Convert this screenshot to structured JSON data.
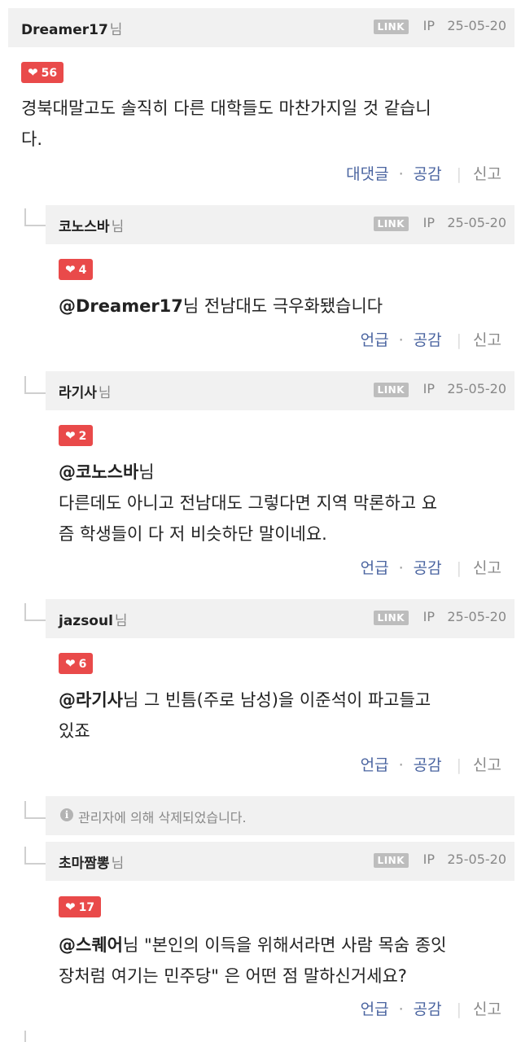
{
  "comments": [
    {
      "nick": "Dreamer17",
      "suffix": "님",
      "link": "LINK",
      "ip": "IP",
      "date": "25-05-20",
      "likes": "56",
      "mention": "",
      "lines": [
        "경북대말고도 솔직히 다른 대학들도 마찬가지일 것 같습니",
        "다."
      ],
      "action1": "대댓글",
      "action2": "공감",
      "action3": "신고"
    },
    {
      "nick": "코노스바",
      "suffix": "님",
      "link": "LINK",
      "ip": "IP",
      "date": "25-05-20",
      "likes": "4",
      "mention": "@Dreamer17",
      "lines": [
        "님 전남대도 극우화됐습니다"
      ],
      "action1": "언급",
      "action2": "공감",
      "action3": "신고"
    },
    {
      "nick": "라기사",
      "suffix": "님",
      "link": "LINK",
      "ip": "IP",
      "date": "25-05-20",
      "likes": "2",
      "mention": "@코노스바",
      "lines": [
        "님",
        "다른데도 아니고 전남대도 그렇다면 지역 막론하고 요",
        "즘 학생들이 다 저 비슷하단 말이네요."
      ],
      "action1": "언급",
      "action2": "공감",
      "action3": "신고"
    },
    {
      "nick": "jazsoul",
      "suffix": "님",
      "link": "LINK",
      "ip": "IP",
      "date": "25-05-20",
      "likes": "6",
      "mention": "@라기사",
      "lines": [
        "님 그 빈틈(주로 남성)을 이준석이 파고들고",
        "있죠"
      ],
      "action1": "언급",
      "action2": "공감",
      "action3": "신고"
    },
    {
      "nick": "초마짬뽕",
      "suffix": "님",
      "link": "LINK",
      "ip": "IP",
      "date": "25-05-20",
      "likes": "17",
      "mention": "@스퀘어",
      "lines": [
        "님 \"본인의 이득을 위해서라면 사람 목숨 종잇",
        "장처럼 여기는 민주당\" 은 어떤 점 말하신거세요?"
      ],
      "action1": "언급",
      "action2": "공감",
      "action3": "신고"
    }
  ],
  "deleted_notice": "관리자에 의해 삭제되었습니다.",
  "colors": {
    "heart": "#e94a4a",
    "header_bg": "#f1f1f1",
    "action_link": "#4a64a0"
  },
  "icons": {
    "like": "heart-icon",
    "deleted": "info-icon"
  }
}
